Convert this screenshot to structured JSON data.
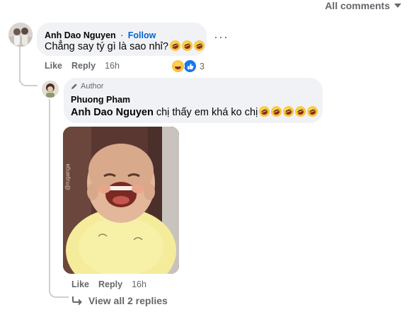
{
  "header": {
    "sort_label": "All comments"
  },
  "comment": {
    "author": "Anh Dao Nguyen",
    "separator": "·",
    "follow_label": "Follow",
    "text": "Chẳng say tý gì là sao nhỉ?",
    "emoji_count": 3,
    "actions": {
      "like": "Like",
      "reply": "Reply",
      "time": "16h"
    },
    "reaction_count": "3"
  },
  "reply": {
    "badge": "Author",
    "author": "Phuong Pham",
    "mention": "Anh Dao Nguyen",
    "text": " chị thấy em khá ko chị",
    "emoji_count": 5,
    "photo_watermark": "@ruganga",
    "actions": {
      "like": "Like",
      "reply": "Reply",
      "time": "16h"
    }
  },
  "footer": {
    "view_replies": "View all 2 replies"
  }
}
